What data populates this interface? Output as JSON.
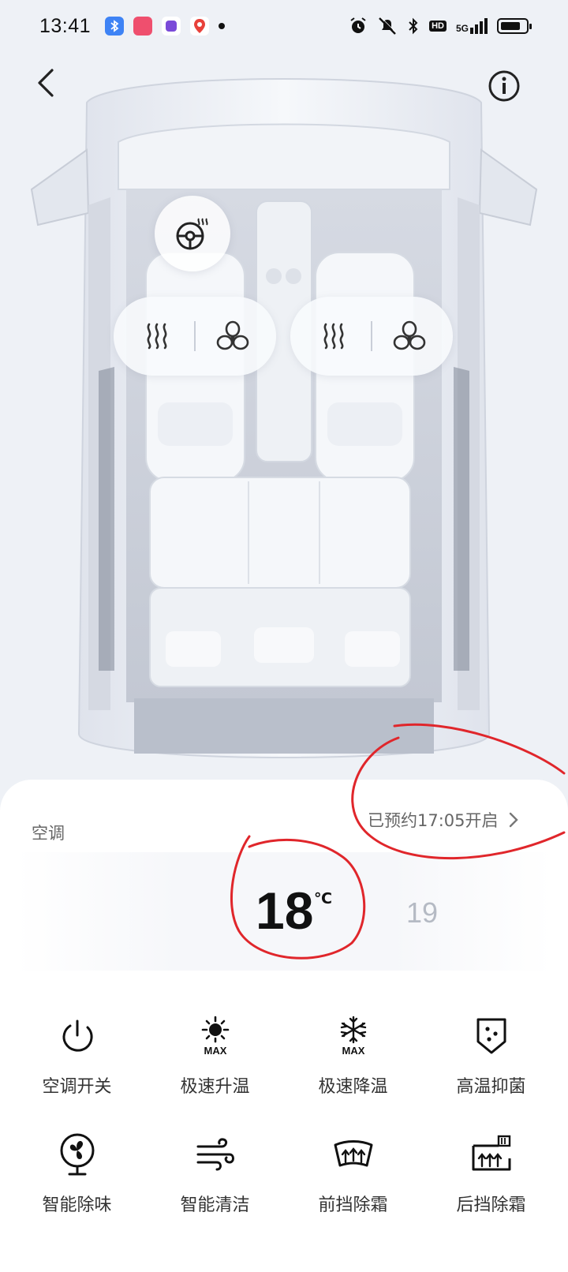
{
  "status_bar": {
    "time": "13:41",
    "hd": "HD",
    "network": "5G"
  },
  "climate": {
    "section_label": "空调",
    "schedule_text": "已预约17:05开启",
    "current_temp": "18",
    "temp_unit": "℃",
    "next_temp": "19"
  },
  "functions": [
    {
      "label": "空调开关",
      "icon": "power-icon"
    },
    {
      "label": "极速升温",
      "icon": "sun-max-icon"
    },
    {
      "label": "极速降温",
      "icon": "snowflake-max-icon"
    },
    {
      "label": "高温抑菌",
      "icon": "shield-sterilize-icon"
    },
    {
      "label": "智能除味",
      "icon": "fan-icon"
    },
    {
      "label": "智能清洁",
      "icon": "wind-icon"
    },
    {
      "label": "前挡除霜",
      "icon": "front-defrost-icon"
    },
    {
      "label": "后挡除霜",
      "icon": "rear-defrost-icon"
    }
  ],
  "icon_max_text": "MAX",
  "colors": {
    "accent_annotation": "#e0262b",
    "background": "#eef1f6",
    "panel": "#ffffff"
  }
}
